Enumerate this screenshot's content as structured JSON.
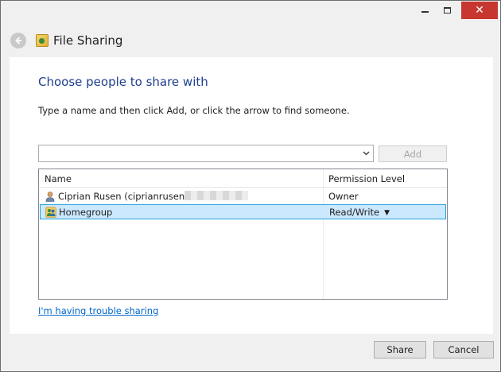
{
  "window": {
    "title": "File Sharing",
    "controls": {
      "minimize": "",
      "maximize": "",
      "close": "✕"
    }
  },
  "content": {
    "heading": "Choose people to share with",
    "instructions": "Type a name and then click Add, or click the arrow to find someone.",
    "name_input": {
      "value": "",
      "placeholder": ""
    },
    "add_label": "Add",
    "list": {
      "columns": {
        "name": "Name",
        "permission": "Permission Level"
      },
      "rows": [
        {
          "name": "Ciprian Rusen (ciprianrusen",
          "permission": "Owner",
          "icon": "user-icon"
        },
        {
          "name": "Homegroup",
          "permission": "Read/Write",
          "icon": "homegroup-icon"
        }
      ]
    },
    "trouble_link": "I'm having trouble sharing"
  },
  "footer": {
    "share_label": "Share",
    "cancel_label": "Cancel"
  }
}
